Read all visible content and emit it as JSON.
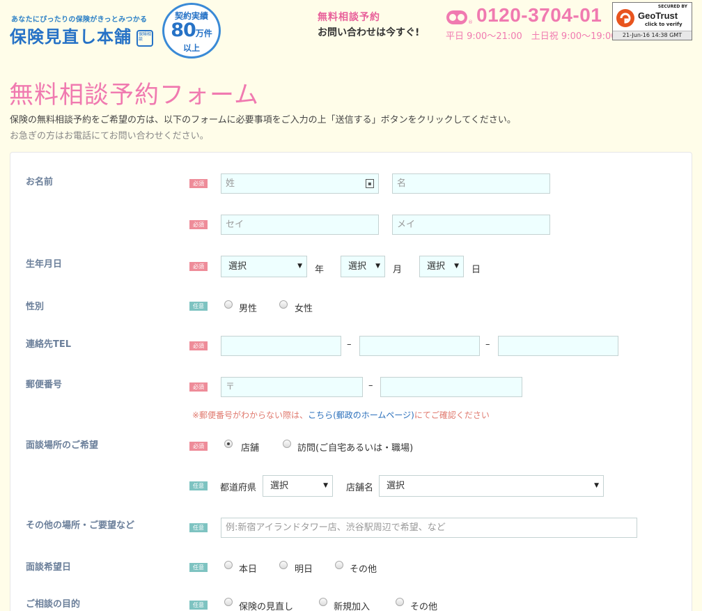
{
  "header": {
    "tagline": "あなたにぴったりの保険がきっとみつかる",
    "logo_name": "保険見直し本舗",
    "logo_stamp": "保険相談",
    "badge": {
      "top": "契約実績",
      "number": "80",
      "unit": "万件",
      "bottom": "以上"
    },
    "consult_title": "無料相談予約",
    "consult_sub": "お問い合わせは今すぐ!",
    "phone_mark": "®",
    "phone": "0120-3704-01",
    "hours": "平日 9:00～21:00　土日祝 9:00～19:00",
    "seal": {
      "secured": "SECURED BY",
      "brand": "GeoTrust",
      "click": "click to verify",
      "date": "21-Jun-16 14:38 GMT"
    }
  },
  "page": {
    "title": "無料相談予約フォーム",
    "intro_1": "保険の無料相談予約をご希望の方は、以下のフォームに必要事項をご入力の上「送信する」ボタンをクリックしてください。",
    "intro_2": "お急ぎの方はお電話にてお問い合わせください。"
  },
  "tags": {
    "required": "必須",
    "optional": "任意"
  },
  "form": {
    "name": {
      "label": "お名前",
      "last_placeholder": "姓",
      "first_placeholder": "名",
      "last_kana_placeholder": "セイ",
      "first_kana_placeholder": "メイ"
    },
    "birth": {
      "label": "生年月日",
      "year_value": "選択",
      "year_unit": "年",
      "month_value": "選択",
      "month_unit": "月",
      "day_value": "選択",
      "day_unit": "日"
    },
    "gender": {
      "label": "性別",
      "options": [
        "男性",
        "女性"
      ]
    },
    "tel": {
      "label": "連絡先TEL",
      "separator": "–"
    },
    "postal": {
      "label": "郵便番号",
      "placeholder": "〒",
      "separator": "–"
    },
    "postal_note": {
      "prefix": "※郵便番号がわからない際は、",
      "link": "こちら(郵政のホームページ)",
      "suffix": "にてご確認ください"
    },
    "place": {
      "label": "面談場所のご希望",
      "options": [
        "店舗",
        "訪問(ご自宅あるいは・職場)"
      ],
      "selected": "店舗",
      "prefecture_label": "都道府県",
      "prefecture_value": "選択",
      "store_label": "店舗名",
      "store_value": "選択"
    },
    "other_place": {
      "label": "その他の場所・ご要望など",
      "placeholder": "例:新宿アイランドタワー店、渋谷駅周辺で希望、など"
    },
    "interview_date": {
      "label": "面談希望日",
      "options": [
        "本日",
        "明日",
        "その他"
      ]
    },
    "purpose": {
      "label": "ご相談の目的",
      "options": [
        "保険の見直し",
        "新規加入",
        "その他"
      ]
    }
  },
  "colors": {
    "accent_pink": "#f07ab0",
    "brand_blue": "#2672c6",
    "required_tag": "#ee8c99",
    "optional_tag": "#7ec3c1",
    "input_bg": "#eeffff"
  }
}
